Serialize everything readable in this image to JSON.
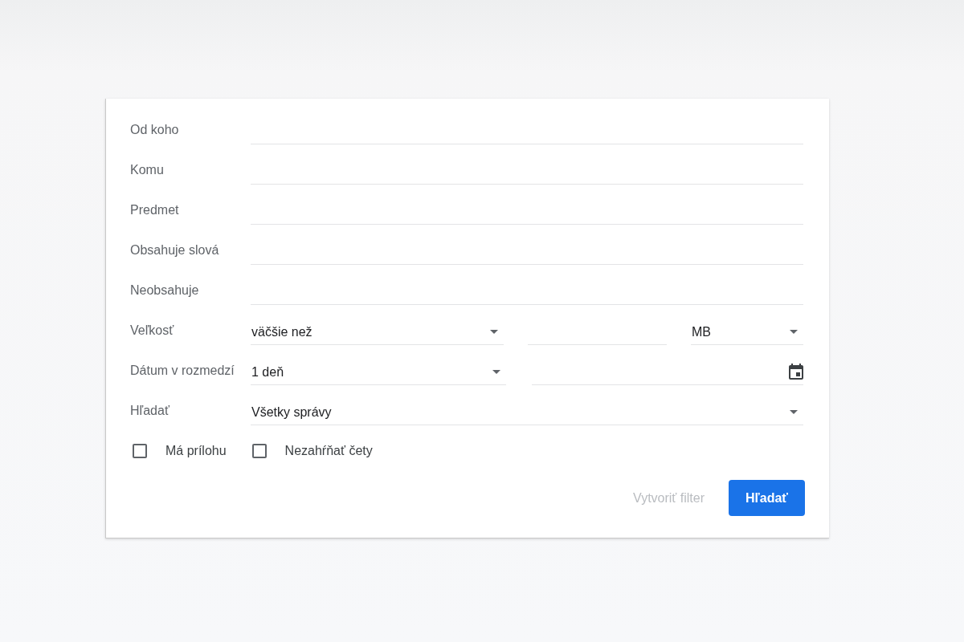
{
  "search_panel": {
    "rows": [
      {
        "kind": "text",
        "label": "Od koho"
      },
      {
        "kind": "text",
        "label": "Komu"
      },
      {
        "kind": "text",
        "label": "Predmet"
      },
      {
        "kind": "text",
        "label": "Obsahuje slová"
      },
      {
        "kind": "text",
        "label": "Neobsahuje"
      },
      {
        "kind": "size",
        "label": "Veľkosť",
        "comparison": "väčšie než",
        "unit": "MB"
      },
      {
        "kind": "date",
        "label": "Dátum v rozmedzí",
        "range": "1 deň"
      },
      {
        "kind": "select",
        "label": "Hľadať",
        "value": "Všetky správy"
      }
    ],
    "checkboxes": [
      {
        "label": "Má prílohu",
        "checked": false
      },
      {
        "label": "Nezahŕňať čety",
        "checked": false
      }
    ],
    "buttons": [
      {
        "kind": "text",
        "label": "Vytvoriť filter",
        "disabled": true
      },
      {
        "kind": "primary",
        "label": "Hľadať",
        "disabled": false
      }
    ]
  }
}
